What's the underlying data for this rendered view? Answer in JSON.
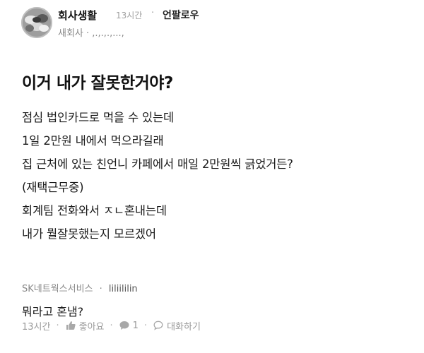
{
  "header": {
    "board_name": "회사생활",
    "time": "13시간",
    "separator": "·",
    "follow_label": "언팔로우",
    "sub_line": "새회사 · ,.,.,.,...,"
  },
  "post": {
    "title": "이거 내가 잘못한거야?",
    "body_lines": [
      "점심 법인카드로 먹을 수 있는데",
      "1일 2만원 내에서 먹으라길래",
      "집 근처에 있는 친언니 카페에서 매일 2만원씩 긁었거든?",
      "(재택근무중)",
      "회계팀 전화와서 ㅈㄴ혼내는데",
      "내가 뭘잘못했는지 모르겠어"
    ]
  },
  "comment": {
    "company": "SK네트웍스서비스",
    "separator": "·",
    "user": "liliililin",
    "text": "뭐라고 혼냄?"
  },
  "footer": {
    "time": "13시간",
    "like_label": "좋아요",
    "comment_count": "1",
    "reply_label": "대화하기",
    "separator": "·"
  },
  "icons": {
    "avatar": "group-hands-avatar",
    "like": "thumbs-up-icon",
    "comment": "speech-bubble-icon",
    "reply": "chat-bubble-icon"
  }
}
